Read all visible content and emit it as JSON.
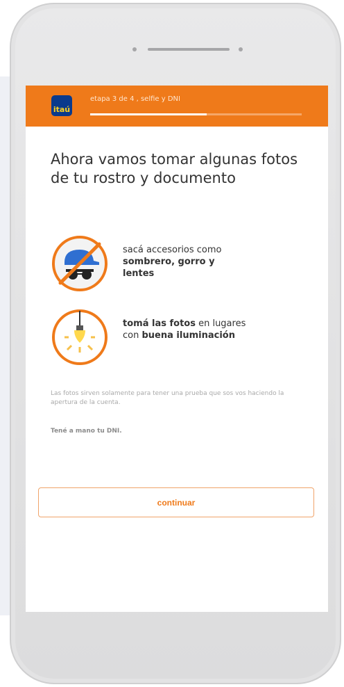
{
  "header": {
    "logo_text": "itaú",
    "step_label": "etapa 3 de 4 , selfie y DNI",
    "progress_fraction": 0.55,
    "bar_color": "#ef7a1a",
    "logo_color": "#0a3a8c"
  },
  "main": {
    "headline": "Ahora vamos tomar algunas fotos de tu rostro y documento",
    "tips": [
      {
        "icon": "no-accessories-icon",
        "text_plain": "sacá accesorios como ",
        "text_bold": "sombrero, gorro y lentes"
      },
      {
        "icon": "light-bulb-icon",
        "text_bold_lead": "tomá las fotos",
        "text_plain": " en lugares con ",
        "text_bold": "buena iluminación"
      }
    ],
    "info_text": "Las fotos sirven solamente para tener una prueba que sos vos haciendo la apertura de la cuenta.",
    "info_strong": "Tené a mano tu DNI."
  },
  "cta": {
    "label": "continuar"
  }
}
